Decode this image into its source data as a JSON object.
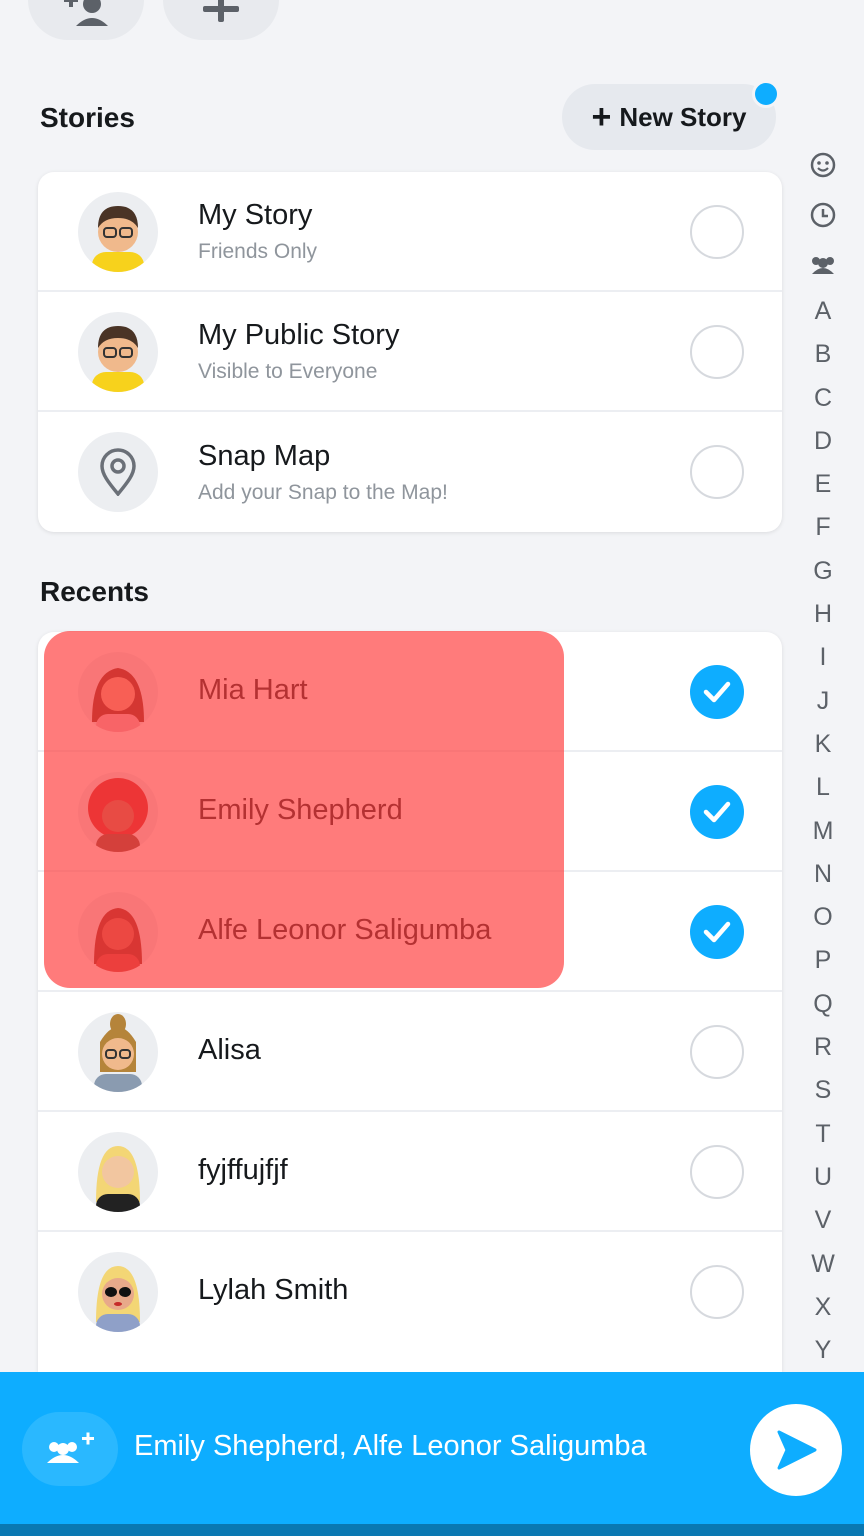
{
  "top_actions": [
    {
      "icon": "add-friend-icon"
    },
    {
      "icon": "plus-icon"
    }
  ],
  "stories": {
    "title": "Stories",
    "new_story_label": "New Story",
    "items": [
      {
        "title": "My Story",
        "subtitle": "Friends Only",
        "icon": "bitmoji-avatar"
      },
      {
        "title": "My Public Story",
        "subtitle": "Visible to Everyone",
        "icon": "bitmoji-avatar"
      },
      {
        "title": "Snap Map",
        "subtitle": "Add your Snap to the Map!",
        "icon": "location-pin-icon"
      }
    ]
  },
  "recents": {
    "title": "Recents",
    "items": [
      {
        "name": "Mia Hart",
        "selected": true
      },
      {
        "name": "Emily Shepherd",
        "selected": true
      },
      {
        "name": "Alfe Leonor Saligumba",
        "selected": true
      },
      {
        "name": "Alisa",
        "selected": false
      },
      {
        "name": "fyjffujfjf",
        "selected": false
      },
      {
        "name": "Lylah Smith",
        "selected": false
      }
    ]
  },
  "index": {
    "icons": [
      "smiley-icon",
      "clock-icon",
      "group-icon"
    ],
    "letters": [
      "A",
      "B",
      "C",
      "D",
      "E",
      "F",
      "G",
      "H",
      "I",
      "J",
      "K",
      "L",
      "M",
      "N",
      "O",
      "P",
      "Q",
      "R",
      "S",
      "T",
      "U",
      "V",
      "W",
      "X",
      "Y"
    ]
  },
  "bottom_bar": {
    "selected_text": "Emily Shepherd, Alfe Leonor Saligumba"
  },
  "colors": {
    "accent": "#0eadff",
    "highlight": "#ff3c3c"
  }
}
